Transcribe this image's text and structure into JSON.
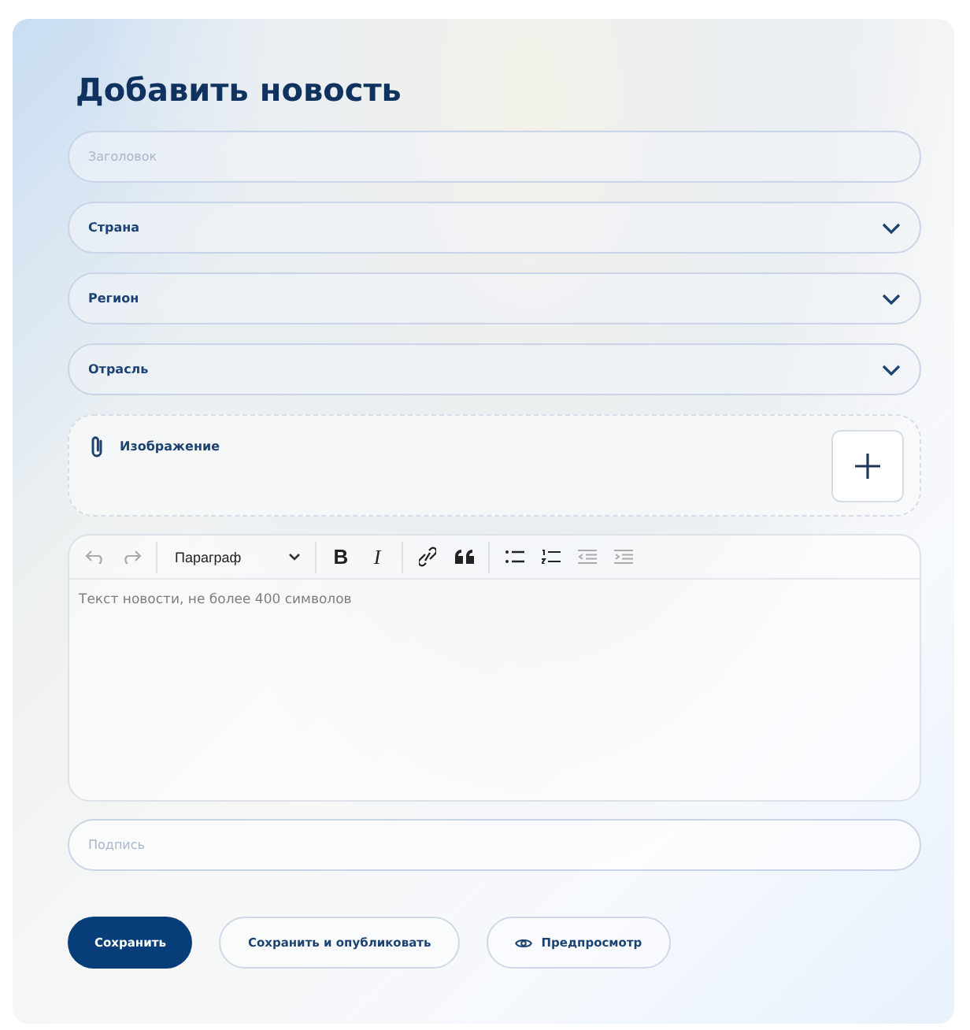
{
  "title": "Добавить новость",
  "fields": [
    {
      "kind": "text",
      "placeholder": "Заголовок"
    },
    {
      "kind": "select",
      "label": "Страна"
    },
    {
      "kind": "select",
      "label": "Регион"
    },
    {
      "kind": "select",
      "label": "Отрасль"
    }
  ],
  "image_upload": {
    "label": "Изображение"
  },
  "editor": {
    "tools": [
      {
        "kind": "undo",
        "disabled": true
      },
      {
        "kind": "redo",
        "disabled": true
      },
      {
        "kind": "separator"
      },
      {
        "kind": "block",
        "label": "Параграф"
      },
      {
        "kind": "separator"
      },
      {
        "kind": "bold",
        "label": "B",
        "disabled": false
      },
      {
        "kind": "italic",
        "label": "I",
        "disabled": false
      },
      {
        "kind": "separator"
      },
      {
        "kind": "link",
        "disabled": false
      },
      {
        "kind": "quote",
        "disabled": false
      },
      {
        "kind": "separator"
      },
      {
        "kind": "bullets",
        "disabled": false
      },
      {
        "kind": "numbers",
        "disabled": false
      },
      {
        "kind": "outdent",
        "disabled": true
      },
      {
        "kind": "indent",
        "disabled": true
      }
    ],
    "placeholder": "Текст новости, не более 400 символов"
  },
  "caption": {
    "placeholder": "Подпись"
  },
  "buttons": [
    {
      "label": "Сохранить",
      "kind": "primary"
    },
    {
      "label": "Сохранить и опубликовать",
      "kind": "secondary"
    },
    {
      "label": "Предпросмотр",
      "kind": "preview"
    }
  ]
}
